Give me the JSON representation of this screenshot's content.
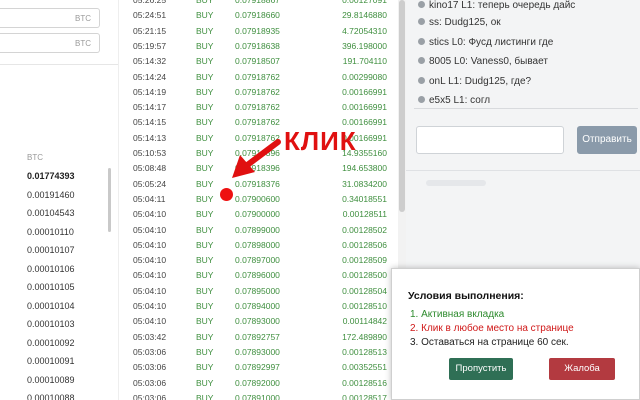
{
  "left_panel": {
    "inputs": [
      {
        "currency": "BTC"
      },
      {
        "currency": "BTC"
      }
    ],
    "column_header": "BTC",
    "values": [
      "0.01774393",
      "0.00191460",
      "0.00104543",
      "0.00010110",
      "0.00010107",
      "0.00010106",
      "0.00010105",
      "0.00010104",
      "0.00010103",
      "0.00010092",
      "0.00010091",
      "0.00010089",
      "0.00010088"
    ]
  },
  "trades": [
    {
      "time": "05:26:25",
      "side": "BUY",
      "price": "0.07918867",
      "amount": "0.00127091"
    },
    {
      "time": "05:24:51",
      "side": "BUY",
      "price": "0.07918660",
      "amount": "29.8146880"
    },
    {
      "time": "05:21:15",
      "side": "BUY",
      "price": "0.07918935",
      "amount": "4.72054310"
    },
    {
      "time": "05:19:57",
      "side": "BUY",
      "price": "0.07918638",
      "amount": "396.198000"
    },
    {
      "time": "05:14:32",
      "side": "BUY",
      "price": "0.07918507",
      "amount": "191.704110"
    },
    {
      "time": "05:14:24",
      "side": "BUY",
      "price": "0.07918762",
      "amount": "0.00299080"
    },
    {
      "time": "05:14:19",
      "side": "BUY",
      "price": "0.07918762",
      "amount": "0.00166991"
    },
    {
      "time": "05:14:17",
      "side": "BUY",
      "price": "0.07918762",
      "amount": "0.00166991"
    },
    {
      "time": "05:14:15",
      "side": "BUY",
      "price": "0.07918762",
      "amount": "0.00166991"
    },
    {
      "time": "05:14:13",
      "side": "BUY",
      "price": "0.07918762",
      "amount": "0.00166991"
    },
    {
      "time": "05:10:53",
      "side": "BUY",
      "price": "0.07918396",
      "amount": "14.9355160"
    },
    {
      "time": "05:08:48",
      "side": "BUY",
      "price": "0.07918396",
      "amount": "194.653800"
    },
    {
      "time": "05:05:24",
      "side": "BUY",
      "price": "0.07918376",
      "amount": "31.0834200"
    },
    {
      "time": "05:04:11",
      "side": "BUY",
      "price": "0.07900600",
      "amount": "0.34018551"
    },
    {
      "time": "05:04:10",
      "side": "BUY",
      "price": "0.07900000",
      "amount": "0.00128511"
    },
    {
      "time": "05:04:10",
      "side": "BUY",
      "price": "0.07899000",
      "amount": "0.00128502"
    },
    {
      "time": "05:04:10",
      "side": "BUY",
      "price": "0.07898000",
      "amount": "0.00128506"
    },
    {
      "time": "05:04:10",
      "side": "BUY",
      "price": "0.07897000",
      "amount": "0.00128509"
    },
    {
      "time": "05:04:10",
      "side": "BUY",
      "price": "0.07896000",
      "amount": "0.00128500"
    },
    {
      "time": "05:04:10",
      "side": "BUY",
      "price": "0.07895000",
      "amount": "0.00128504"
    },
    {
      "time": "05:04:10",
      "side": "BUY",
      "price": "0.07894000",
      "amount": "0.00128510"
    },
    {
      "time": "05:04:10",
      "side": "BUY",
      "price": "0.07893000",
      "amount": "0.00114842"
    },
    {
      "time": "05:03:42",
      "side": "BUY",
      "price": "0.07892757",
      "amount": "172.489890"
    },
    {
      "time": "05:03:06",
      "side": "BUY",
      "price": "0.07893000",
      "amount": "0.00128513"
    },
    {
      "time": "05:03:06",
      "side": "BUY",
      "price": "0.07892997",
      "amount": "0.00352551"
    },
    {
      "time": "05:03:06",
      "side": "BUY",
      "price": "0.07892000",
      "amount": "0.00128516"
    },
    {
      "time": "05:03:06",
      "side": "BUY",
      "price": "0.07891000",
      "amount": "0.00128517"
    }
  ],
  "chat": {
    "messages": [
      "kino17 L1: теперь очередь дайс",
      "ss: Dudg125, ок",
      "stics L0: Фусд листинги где",
      "8005 L0: Vaness0, бывает",
      "onL L1: Dudg125, где?",
      "e5x5 L1: согл"
    ],
    "send_label": "Отправить"
  },
  "annotation": {
    "label": "КЛИК",
    "color": "#e01010"
  },
  "popup": {
    "title": "Условия выполнения:",
    "conditions": [
      "1. Активная вкладка",
      "2. Клик в любое место на странице",
      "3. Оставаться на странице 60 сек."
    ],
    "skip_label": "Пропустить",
    "report_label": "Жалоба"
  },
  "colors": {
    "buy": "#3f8f3f",
    "annotation": "#e01010",
    "skip_button": "#2f6f55",
    "report_button": "#b33a40",
    "send_button": "#8a9aaa"
  }
}
